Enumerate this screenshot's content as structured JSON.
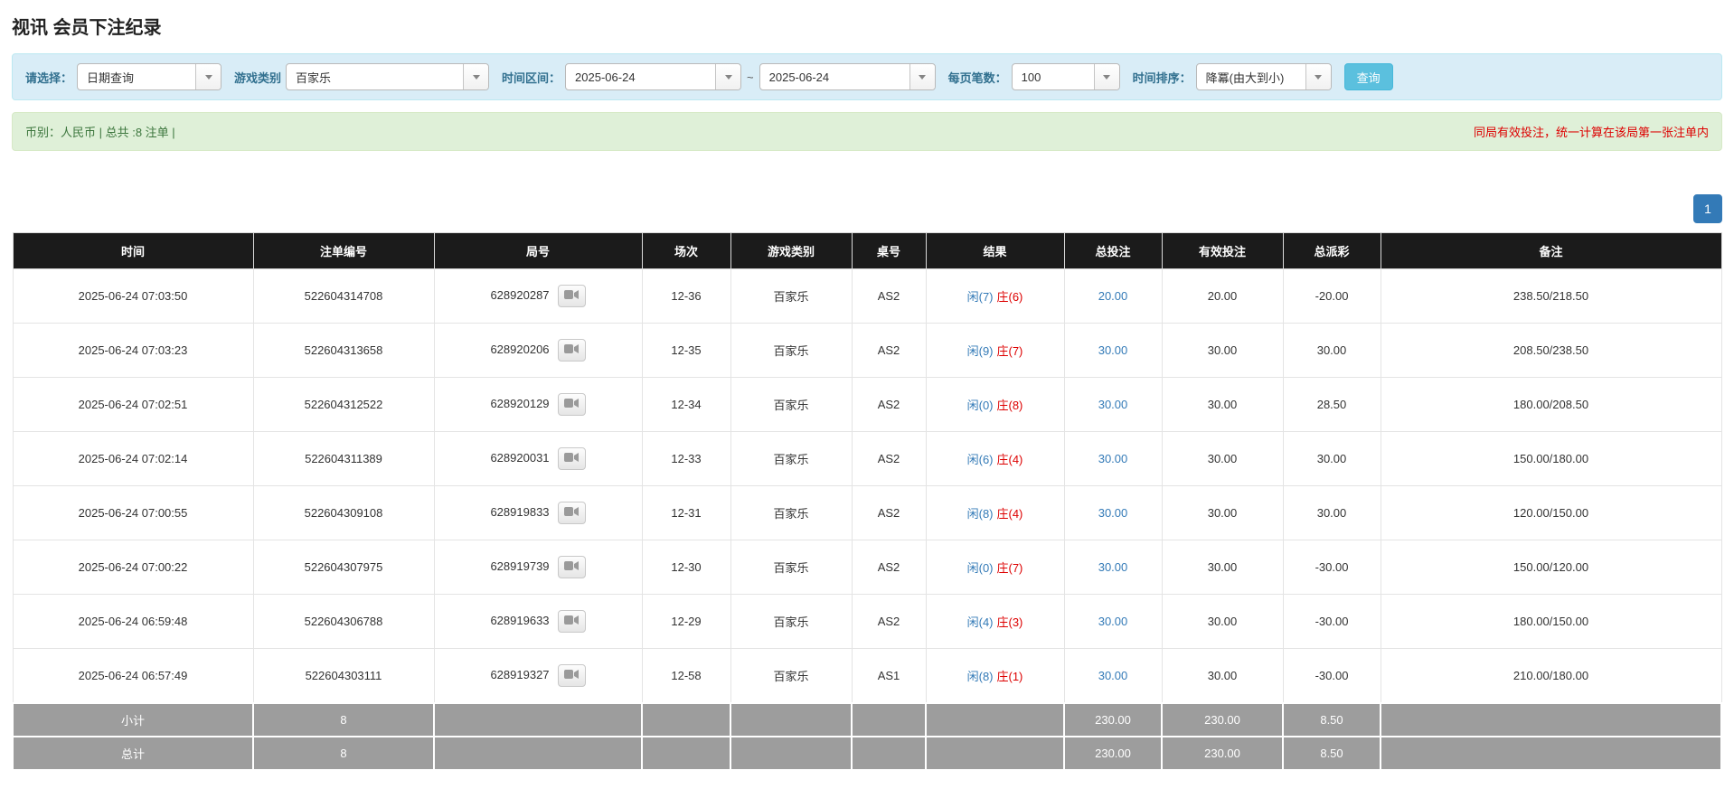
{
  "page": {
    "title": "视讯 会员下注纪录"
  },
  "colors": {
    "accent_blue": "#337ab7",
    "search_button_blue": "#5bc0de",
    "red": "#dd0000",
    "status_green": "#3c763d",
    "table_header_bg": "#1b1b1b",
    "summary_bg": "#9d9d9d",
    "filter_bar_bg": "#d9edf7",
    "status_bar_bg": "#dff0d8"
  },
  "filters": {
    "select_label": "请选择：",
    "select_value": "日期查询",
    "game_type_label": "游戏类别",
    "game_type_value": "百家乐",
    "date_range_label": "时间区间：",
    "date_from": "2025-06-24",
    "date_tilde": "~",
    "date_to": "2025-06-24",
    "page_size_label": "每页笔数：",
    "page_size_value": "100",
    "sort_label": "时间排序：",
    "sort_value": "降冪(由大到小)",
    "search_button": "查询"
  },
  "status": {
    "left": "币别：人民币 | 总共 :8 注单 |",
    "right": "同局有效投注，统一计算在该局第一张注单内"
  },
  "pagination": {
    "page": "1"
  },
  "table": {
    "headers": [
      "时间",
      "注单编号",
      "局号",
      "场次",
      "游戏类别",
      "桌号",
      "结果",
      "总投注",
      "有效投注",
      "总派彩",
      "备注"
    ],
    "rows": [
      {
        "time": "2025-06-24 07:03:50",
        "bet_id": "522604314708",
        "round_id": "628920287",
        "session": "12-36",
        "game": "百家乐",
        "table_no": "AS2",
        "result_player": "闲(7)",
        "result_banker": "庄(6)",
        "total_bet": "20.00",
        "valid_bet": "20.00",
        "payout": "-20.00",
        "remark": "238.50/218.50"
      },
      {
        "time": "2025-06-24 07:03:23",
        "bet_id": "522604313658",
        "round_id": "628920206",
        "session": "12-35",
        "game": "百家乐",
        "table_no": "AS2",
        "result_player": "闲(9)",
        "result_banker": "庄(7)",
        "total_bet": "30.00",
        "valid_bet": "30.00",
        "payout": "30.00",
        "remark": "208.50/238.50"
      },
      {
        "time": "2025-06-24 07:02:51",
        "bet_id": "522604312522",
        "round_id": "628920129",
        "session": "12-34",
        "game": "百家乐",
        "table_no": "AS2",
        "result_player": "闲(0)",
        "result_banker": "庄(8)",
        "total_bet": "30.00",
        "valid_bet": "30.00",
        "payout": "28.50",
        "remark": "180.00/208.50"
      },
      {
        "time": "2025-06-24 07:02:14",
        "bet_id": "522604311389",
        "round_id": "628920031",
        "session": "12-33",
        "game": "百家乐",
        "table_no": "AS2",
        "result_player": "闲(6)",
        "result_banker": "庄(4)",
        "total_bet": "30.00",
        "valid_bet": "30.00",
        "payout": "30.00",
        "remark": "150.00/180.00"
      },
      {
        "time": "2025-06-24 07:00:55",
        "bet_id": "522604309108",
        "round_id": "628919833",
        "session": "12-31",
        "game": "百家乐",
        "table_no": "AS2",
        "result_player": "闲(8)",
        "result_banker": "庄(4)",
        "total_bet": "30.00",
        "valid_bet": "30.00",
        "payout": "30.00",
        "remark": "120.00/150.00"
      },
      {
        "time": "2025-06-24 07:00:22",
        "bet_id": "522604307975",
        "round_id": "628919739",
        "session": "12-30",
        "game": "百家乐",
        "table_no": "AS2",
        "result_player": "闲(0)",
        "result_banker": "庄(7)",
        "total_bet": "30.00",
        "valid_bet": "30.00",
        "payout": "-30.00",
        "remark": "150.00/120.00"
      },
      {
        "time": "2025-06-24 06:59:48",
        "bet_id": "522604306788",
        "round_id": "628919633",
        "session": "12-29",
        "game": "百家乐",
        "table_no": "AS2",
        "result_player": "闲(4)",
        "result_banker": "庄(3)",
        "total_bet": "30.00",
        "valid_bet": "30.00",
        "payout": "-30.00",
        "remark": "180.00/150.00"
      },
      {
        "time": "2025-06-24 06:57:49",
        "bet_id": "522604303111",
        "round_id": "628919327",
        "session": "12-58",
        "game": "百家乐",
        "table_no": "AS1",
        "result_player": "闲(8)",
        "result_banker": "庄(1)",
        "total_bet": "30.00",
        "valid_bet": "30.00",
        "payout": "-30.00",
        "remark": "210.00/180.00"
      }
    ],
    "subtotal": {
      "label": "小计",
      "count": "8",
      "total_bet": "230.00",
      "valid_bet": "230.00",
      "payout": "8.50"
    },
    "total": {
      "label": "总计",
      "count": "8",
      "total_bet": "230.00",
      "valid_bet": "230.00",
      "payout": "8.50"
    }
  }
}
